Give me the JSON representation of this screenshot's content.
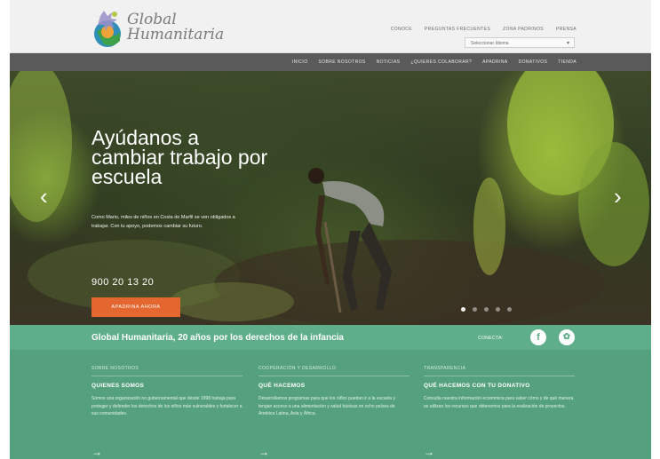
{
  "header": {
    "logo_line1": "Global",
    "logo_line2": "Humanitaria",
    "top_links": [
      "CONOCE",
      "PREGUNTAS FRECUENTES",
      "ZONA PADRINOS",
      "PRENSA"
    ],
    "language_select": "Seleccionar Idioma"
  },
  "nav": {
    "items": [
      "INICIO",
      "SOBRE NOSOTROS",
      "NOTICIAS",
      "¿QUIERES COLABORAR?",
      "APADRINA",
      "DONATIVOS",
      "TIENDA"
    ]
  },
  "hero": {
    "title": "Ayúdanos a cambiar trabajo por escuela",
    "body": "Como Mario, miles de niños en Costa de Marfil se ven obligados a trabajar. Con tu apoyo, podemos cambiar su futuro.",
    "phone": "900 20 13 20",
    "cta_label": "APADRINA AHORA",
    "slide_count": 5,
    "active_slide": 1
  },
  "greenbar": {
    "tagline": "Global Humanitaria, 20 años por los derechos de la infancia",
    "connect_label": "CONECTA:"
  },
  "columns": [
    {
      "kicker": "SOBRE NOSOTROS",
      "heading": "QUIENES SOMOS",
      "text": "Somos una organización no gubernamental que desde 1998 trabaja para proteger y defender los derechos de los niños más vulnerables y fortalecer a sus comunidades.",
      "more": "→"
    },
    {
      "kicker": "COOPERACIÓN Y DESARROLLO",
      "heading": "QUÉ HACEMOS",
      "text": "Desarrollamos programas para que los niños puedan ir a la escuela y tengan acceso a una alimentación y salud básicas en ocho países de América Latina, Asia y África.",
      "more": "→"
    },
    {
      "kicker": "TRANSPARENCIA",
      "heading": "QUÉ HACEMOS CON TU DONATIVO",
      "text": "Consulta nuestra información económica para saber cómo y de qué manera se utilizan los recursos que obtenemos para la realización de proyectos.",
      "more": "→"
    }
  ],
  "colors": {
    "nav_bg": "#5a5a5a",
    "accent_orange": "#e3672f",
    "green_bar": "#5fae8a",
    "green_bottom": "#55a17e"
  }
}
